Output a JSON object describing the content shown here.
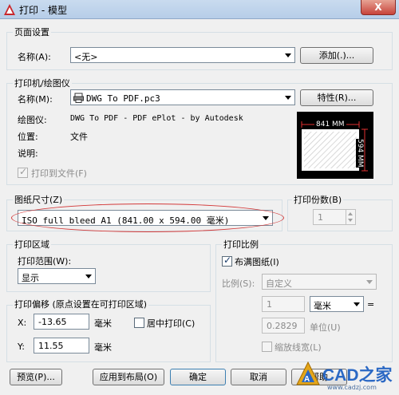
{
  "window": {
    "title": "打印 - 模型",
    "close_glyph": "X"
  },
  "page_setup": {
    "group_label": "页面设置",
    "name_label": "名称(A):",
    "name_value": "<无>",
    "add_button": "添加(.)..."
  },
  "printer": {
    "group_label": "打印机/绘图仪",
    "name_label": "名称(M):",
    "name_value": "DWG To PDF.pc3",
    "properties_button": "特性(R)...",
    "plotter_label": "绘图仪:",
    "plotter_value": "DWG To PDF - PDF ePlot - by Autodesk",
    "location_label": "位置:",
    "location_value": "文件",
    "description_label": "说明:",
    "print_to_file_label": "打印到文件(F)",
    "print_to_file_checked": true,
    "preview_width_label": "841 MM",
    "preview_height_label": "594 MM"
  },
  "paper_size": {
    "group_label": "图纸尺寸(Z)",
    "value": "ISO full bleed A1 (841.00 x 594.00 毫米)"
  },
  "copies": {
    "label": "打印份数(B)",
    "value": "1"
  },
  "plot_area": {
    "group_label": "打印区域",
    "range_label": "打印范围(W):",
    "range_value": "显示"
  },
  "plot_offset": {
    "group_label": "打印偏移 (原点设置在可打印区域)",
    "x_label": "X:",
    "x_value": "-13.65",
    "x_unit": "毫米",
    "y_label": "Y:",
    "y_value": "11.55",
    "y_unit": "毫米",
    "center_label": "居中打印(C)",
    "center_checked": false
  },
  "plot_scale": {
    "group_label": "打印比例",
    "fit_label": "布满图纸(I)",
    "fit_checked": true,
    "scale_label": "比例(S):",
    "scale_value": "自定义",
    "value1": "1",
    "unit_value": "毫米",
    "equals": "=",
    "value2": "0.2829",
    "units_label": "单位(U)",
    "lineweights_label": "缩放线宽(L)",
    "lineweights_checked": false
  },
  "footer": {
    "preview_button": "预览(P)...",
    "apply_button": "应用到布局(O)",
    "ok_button": "确定",
    "cancel_button": "取消",
    "help_button": "帮助"
  },
  "watermark": {
    "brand": "CAD之家",
    "url": "www.cadzj.com"
  },
  "colors": {
    "title_bar": "#c4d7ec",
    "close_button": "#c7433b",
    "annotation_red": "#d33a3a",
    "preview_bg": "#000000"
  }
}
